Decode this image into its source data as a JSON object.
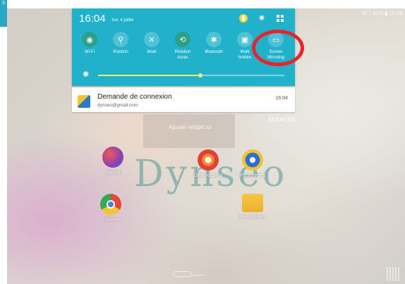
{
  "corner_tab": {
    "text": "3"
  },
  "status_bar": {
    "right_text": "✉ ◔ 42% ▮ 16:04"
  },
  "shade": {
    "time": "16:04",
    "date": "lun. 4 juillet",
    "top_icons": [
      "user-icon",
      "gear-icon",
      "grid-icon"
    ],
    "toggles": [
      {
        "label": "Wi-Fi",
        "icon": "wifi-icon",
        "glyph": "◉",
        "on": true
      },
      {
        "label": "Position",
        "icon": "location-icon",
        "glyph": "⚲",
        "on": false
      },
      {
        "label": "Muet",
        "icon": "mute-icon",
        "glyph": "✕",
        "on": false
      },
      {
        "label": "Rotation\nécran",
        "icon": "rotation-icon",
        "glyph": "⟲",
        "on": true
      },
      {
        "label": "Bluetooth",
        "icon": "bluetooth-icon",
        "glyph": "✱",
        "on": false
      },
      {
        "label": "Multi\nfenêtre",
        "icon": "multiwindow-icon",
        "glyph": "▣",
        "on": false
      },
      {
        "label": "Screen\nMirroring",
        "icon": "screen-mirroring-icon",
        "glyph": "▭",
        "on": false
      }
    ],
    "brightness_level": 0.55,
    "accent_color": "#21b1cb"
  },
  "notification": {
    "title": "Demande de connexion",
    "subtitle": "dynseo@gmail.com",
    "time": "16:04"
  },
  "clear_label": "EFFACER",
  "widget_label": "Ajouter widget ici",
  "logo_text": "Dynseo",
  "apps": [
    {
      "label": "Stimuli",
      "icon": "stimuli-app-icon"
    },
    {
      "label": "Dynseo-Jeux",
      "icon": "dynseo-app-icon"
    },
    {
      "label": "Paramètres",
      "icon": "settings-app-icon"
    },
    {
      "label": "Chrome",
      "icon": "chrome-app-icon"
    },
    {
      "label": "Mes fichiers",
      "icon": "files-app-icon"
    }
  ],
  "highlight_color": "#e8242a"
}
